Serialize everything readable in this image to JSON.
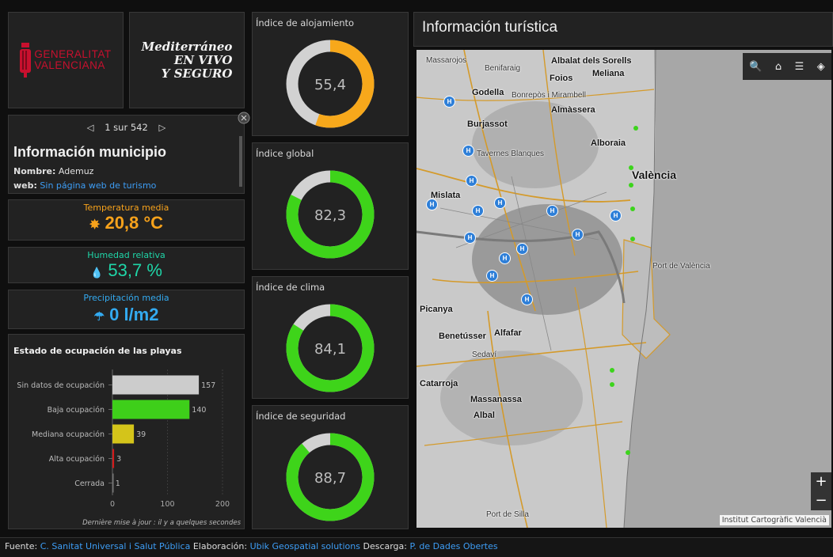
{
  "logos": {
    "generalitat_line1": "GENERALITAT",
    "generalitat_line2": "VALENCIANA",
    "med_line1": "Mediterráneo",
    "med_line2": "EN VIVO",
    "med_line3": "Y SEGURO"
  },
  "municipio": {
    "pager_prev": "◁",
    "pager_text": "1 sur 542",
    "pager_next": "▷",
    "title": "Información municipio",
    "nombre_label": "Nombre:",
    "nombre_value": "Ademuz",
    "web_label": "web:",
    "web_value": "Sin página web de turismo"
  },
  "stats": {
    "temperatura": {
      "label": "Temperatura media",
      "icon": "✸",
      "value": "20,8 °C",
      "color": "#f7a21b"
    },
    "humedad": {
      "label": "Humedad relativa",
      "icon": "💧",
      "value": "53,7 %",
      "color": "#1fd6a8"
    },
    "precipitacion": {
      "label": "Precipitación media",
      "icon": "☂",
      "value": "0 l/m2",
      "color": "#33aaf0"
    }
  },
  "gauges": [
    {
      "title": "Índice de alojamiento",
      "value": "55,4",
      "fraction": 0.554,
      "color": "#f7a81b"
    },
    {
      "title": "Índice global",
      "value": "82,3",
      "fraction": 0.823,
      "color": "#3ed41a"
    },
    {
      "title": "Índice de clima",
      "value": "84,1",
      "fraction": 0.841,
      "color": "#3ed41a"
    },
    {
      "title": "Índice de seguridad",
      "value": "88,7",
      "fraction": 0.887,
      "color": "#3ed41a"
    }
  ],
  "chart_data": {
    "type": "bar",
    "title": "Estado de ocupación de las playas",
    "orientation": "horizontal",
    "categories": [
      "Sin datos de ocupación",
      "Baja ocupación",
      "Mediana ocupación",
      "Alta ocupación",
      "Cerrada"
    ],
    "values": [
      157,
      140,
      39,
      3,
      1
    ],
    "colors": [
      "#cccccc",
      "#3ecf1a",
      "#d4c41a",
      "#d41a1a",
      "#777777"
    ],
    "xlim": [
      0,
      200
    ],
    "xticks": [
      0,
      100,
      200
    ],
    "note": "Dernière mise à jour : il y a quelques secondes"
  },
  "map": {
    "title": "Información turística",
    "tools": [
      "🔍",
      "⌂",
      "☰",
      "◈"
    ],
    "zoom_in": "+",
    "zoom_out": "−",
    "attribution": "Institut Cartogràfic Valencià",
    "places": [
      "Massarojos",
      "Benifaraig",
      "Albalat dels Sorells",
      "Meliana",
      "Foios",
      "Godella",
      "Bonrepòs i Mirambell",
      "Almàssera",
      "Burjassot",
      "Alboraia",
      "Tavernes Blanques",
      "València",
      "Mislata",
      "Port de València",
      "Picanya",
      "Benetússer",
      "Alfafar",
      "Sedaví",
      "Catarroja",
      "Massanassa",
      "Albal",
      "Port de Silla"
    ]
  },
  "footer": {
    "fuente_label": "Fuente:",
    "fuente_link": "C. Sanitat Universal i Salut Pública",
    "elab_label": "Elaboración:",
    "elab_link": "Ubik Geospatial solutions",
    "desc_label": "Descarga:",
    "desc_link": "P. de Dades Obertes"
  }
}
